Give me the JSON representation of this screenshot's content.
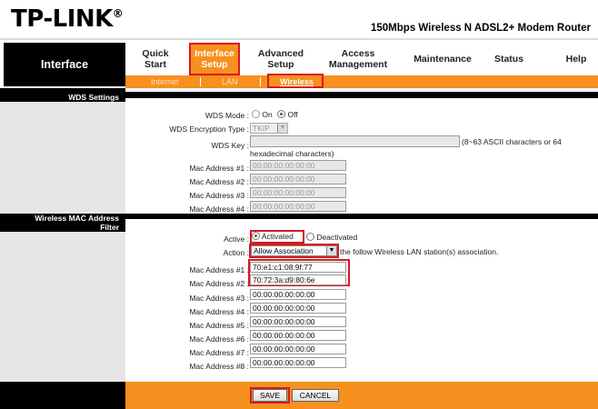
{
  "header": {
    "logo": "TP-LINK",
    "logo_mark": "®",
    "model": "150Mbps Wireless N ADSL2+ Modem Router"
  },
  "nav": {
    "section": "Interface",
    "items": [
      {
        "label": "Quick\nStart",
        "active": false
      },
      {
        "label": "Interface\nSetup",
        "active": true
      },
      {
        "label": "Advanced\nSetup",
        "active": false
      },
      {
        "label": "Access\nManagement",
        "active": false
      },
      {
        "label": "Maintenance",
        "active": false
      },
      {
        "label": "Status",
        "active": false
      },
      {
        "label": "Help",
        "active": false
      }
    ],
    "subitems": [
      {
        "label": "Internet",
        "active": false
      },
      {
        "label": "LAN",
        "active": false
      },
      {
        "label": "Wireless",
        "active": true
      }
    ]
  },
  "wds": {
    "section_title": "WDS Settings",
    "mode_label": "WDS Mode :",
    "mode_on": "On",
    "mode_off": "Off",
    "mode_value": "Off",
    "enc_label": "WDS Encryption Type :",
    "enc_value": "TKIP",
    "key_label": "WDS Key :",
    "key_value": "",
    "key_hint": "(8~63 ASCII characters or 64",
    "key_hint2": "hexadecimal characters)",
    "macs": [
      {
        "label": "Mac Address #1 :",
        "value": "00:00:00:00:00:00"
      },
      {
        "label": "Mac Address #2 :",
        "value": "00:00:00:00:00:00"
      },
      {
        "label": "Mac Address #3 :",
        "value": "00:00:00:00:00:00"
      },
      {
        "label": "Mac Address #4 :",
        "value": "00:00:00:00:00:00"
      }
    ]
  },
  "mac_filter": {
    "section_title_1": "Wireless MAC Address",
    "section_title_2": "Filter",
    "active_label": "Active :",
    "activated": "Activated",
    "deactivated": "Deactivated",
    "action_label": "Action :",
    "action_value": "Allow Association",
    "action_suffix": "the follow Wireless LAN station(s) association.",
    "macs": [
      {
        "label": "Mac Address #1 :",
        "value": "70:e1:c1:08:9f:77"
      },
      {
        "label": "Mac Address #2 :",
        "value": "70:72:3a:d9:80:6e"
      },
      {
        "label": "Mac Address #3 :",
        "value": "00:00:00:00:00:00"
      },
      {
        "label": "Mac Address #4 :",
        "value": "00:00:00:00:00:00"
      },
      {
        "label": "Mac Address #5 :",
        "value": "00:00:00:00:00:00"
      },
      {
        "label": "Mac Address #6 :",
        "value": "00:00:00:00:00:00"
      },
      {
        "label": "Mac Address #7 :",
        "value": "00:00:00:00:00:00"
      },
      {
        "label": "Mac Address #8 :",
        "value": "00:00:00:00:00:00"
      }
    ]
  },
  "footer": {
    "save": "SAVE",
    "cancel": "CANCEL"
  },
  "colors": {
    "accent": "#f7901e",
    "highlight": "#d71920"
  }
}
